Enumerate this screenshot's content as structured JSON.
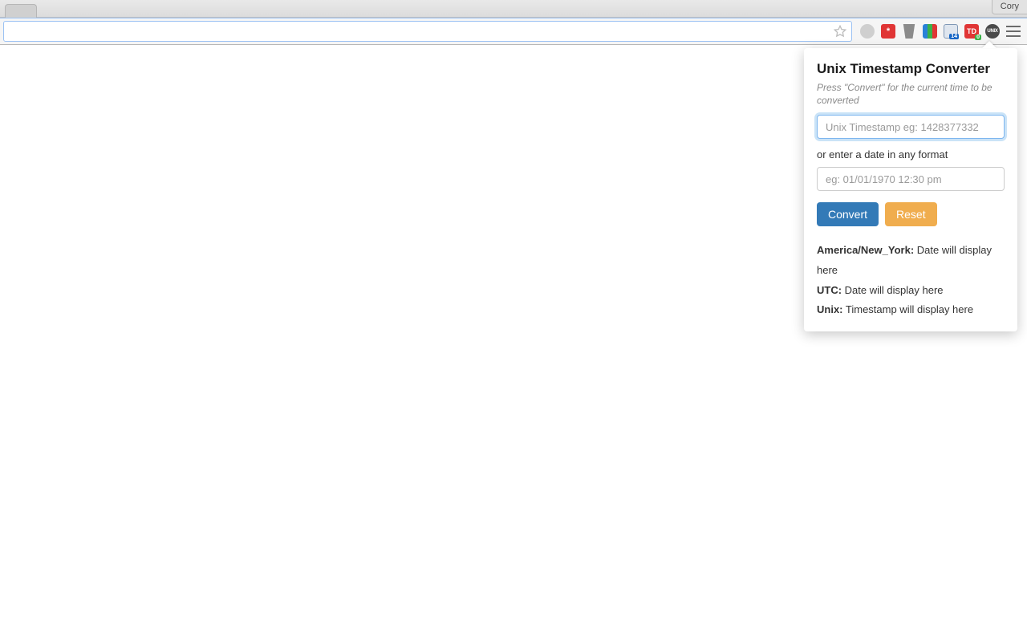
{
  "system": {
    "account_name": "Cory"
  },
  "toolbar": {
    "extensions": {
      "red_label": "*",
      "cal_badge": "14",
      "td_label": "TD",
      "td_badge": "0",
      "unix_label": "UNIX"
    }
  },
  "popup": {
    "title": "Unix Timestamp Converter",
    "hint": "Press \"Convert\" for the current time to be converted",
    "ts_placeholder": "Unix Timestamp eg: 1428377332",
    "or_label": "or enter a date in any format",
    "date_placeholder": "eg: 01/01/1970 12:30 pm",
    "convert_label": "Convert",
    "reset_label": "Reset",
    "results": {
      "tz_label": "America/New_York:",
      "tz_value": "Date will display here",
      "utc_label": "UTC:",
      "utc_value": "Date will display here",
      "unix_label": "Unix:",
      "unix_value": "Timestamp will display here"
    }
  }
}
